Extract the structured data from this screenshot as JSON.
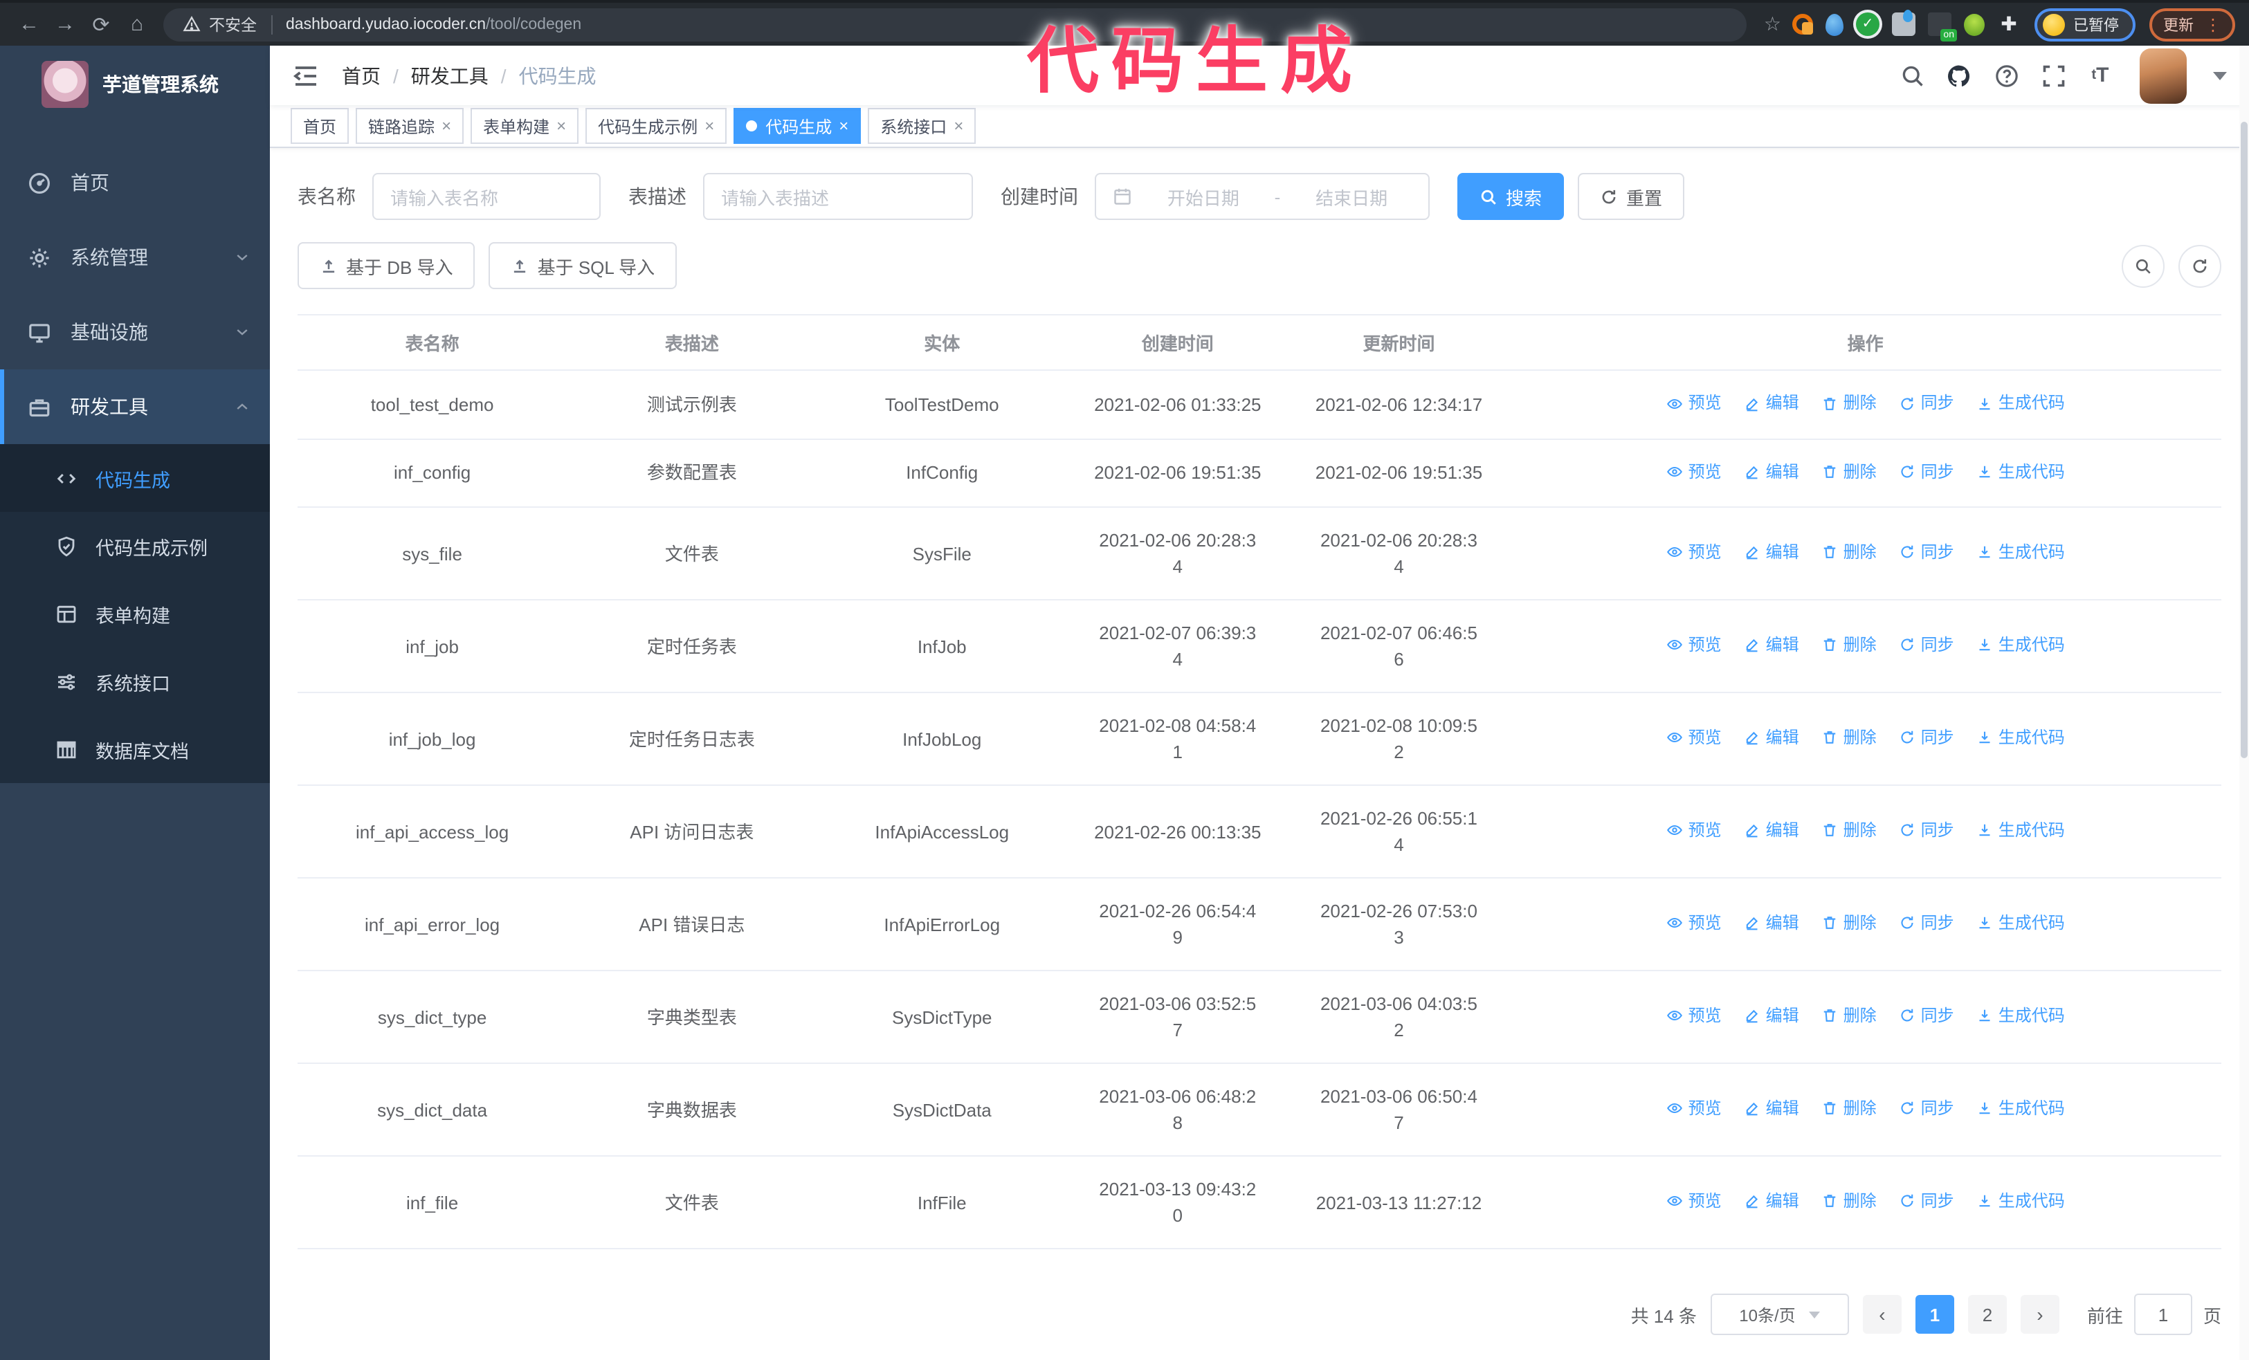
{
  "browser": {
    "security_label": "不安全",
    "url_host": "dashboard.yudao.iocoder.cn",
    "url_path": "/tool/codegen",
    "profile_chip_label": "已暂停",
    "update_button_label": "更新"
  },
  "annotation": {
    "text": "代码生成",
    "color": "#fb3e63"
  },
  "sidebar": {
    "logo_title": "芋道管理系统",
    "menu": [
      {
        "label": "首页"
      },
      {
        "label": "系统管理"
      },
      {
        "label": "基础设施"
      },
      {
        "label": "研发工具"
      }
    ],
    "submenu": [
      {
        "label": "代码生成"
      },
      {
        "label": "代码生成示例"
      },
      {
        "label": "表单构建"
      },
      {
        "label": "系统接口"
      },
      {
        "label": "数据库文档"
      }
    ]
  },
  "navbar": {
    "breadcrumb": [
      "首页",
      "研发工具",
      "代码生成"
    ],
    "breadcrumb_sep": "/"
  },
  "tabs": [
    {
      "label": "首页"
    },
    {
      "label": "链路追踪"
    },
    {
      "label": "表单构建"
    },
    {
      "label": "代码生成示例"
    },
    {
      "label": "代码生成",
      "active": true
    },
    {
      "label": "系统接口"
    }
  ],
  "filters": {
    "table_name_label": "表名称",
    "table_name_placeholder": "请输入表名称",
    "table_desc_label": "表描述",
    "table_desc_placeholder": "请输入表描述",
    "create_time_label": "创建时间",
    "start_date_placeholder": "开始日期",
    "range_separator": "-",
    "end_date_placeholder": "结束日期",
    "search_label": "搜索",
    "reset_label": "重置"
  },
  "toolbar": {
    "db_import_label": "基于 DB 导入",
    "sql_import_label": "基于 SQL 导入"
  },
  "table": {
    "headers": [
      "表名称",
      "表描述",
      "实体",
      "创建时间",
      "更新时间",
      "操作"
    ],
    "row_actions": [
      {
        "key": "preview",
        "icon": "eye",
        "label": "预览"
      },
      {
        "key": "edit",
        "icon": "edit",
        "label": "编辑"
      },
      {
        "key": "delete",
        "icon": "delete",
        "label": "删除"
      },
      {
        "key": "sync",
        "icon": "sync",
        "label": "同步"
      },
      {
        "key": "generate",
        "icon": "download",
        "label": "生成代码"
      }
    ],
    "rows": [
      {
        "name": "tool_test_demo",
        "description": "测试示例表",
        "entity": "ToolTestDemo",
        "created": "2021-02-06 01:33:25",
        "updated": "2021-02-06 12:34:17"
      },
      {
        "name": "inf_config",
        "description": "参数配置表",
        "entity": "InfConfig",
        "created": "2021-02-06 19:51:35",
        "updated": "2021-02-06 19:51:35"
      },
      {
        "name": "sys_file",
        "description": "文件表",
        "entity": "SysFile",
        "created": "2021-02-06 20:28:3\n4",
        "updated": "2021-02-06 20:28:3\n4"
      },
      {
        "name": "inf_job",
        "description": "定时任务表",
        "entity": "InfJob",
        "created": "2021-02-07 06:39:3\n4",
        "updated": "2021-02-07 06:46:5\n6"
      },
      {
        "name": "inf_job_log",
        "description": "定时任务日志表",
        "entity": "InfJobLog",
        "created": "2021-02-08 04:58:4\n1",
        "updated": "2021-02-08 10:09:5\n2"
      },
      {
        "name": "inf_api_access_log",
        "description": "API 访问日志表",
        "entity": "InfApiAccessLog",
        "created": "2021-02-26 00:13:35",
        "updated": "2021-02-26 06:55:1\n4"
      },
      {
        "name": "inf_api_error_log",
        "description": "API 错误日志",
        "entity": "InfApiErrorLog",
        "created": "2021-02-26 06:54:4\n9",
        "updated": "2021-02-26 07:53:0\n3"
      },
      {
        "name": "sys_dict_type",
        "description": "字典类型表",
        "entity": "SysDictType",
        "created": "2021-03-06 03:52:5\n7",
        "updated": "2021-03-06 04:03:5\n2"
      },
      {
        "name": "sys_dict_data",
        "description": "字典数据表",
        "entity": "SysDictData",
        "created": "2021-03-06 06:48:2\n8",
        "updated": "2021-03-06 06:50:4\n7"
      },
      {
        "name": "inf_file",
        "description": "文件表",
        "entity": "InfFile",
        "created": "2021-03-13 09:43:2\n0",
        "updated": "2021-03-13 11:27:12"
      }
    ]
  },
  "pagination": {
    "total_text": "共 14 条",
    "page_size": "10条/页",
    "pages": [
      "1",
      "2"
    ],
    "current_page": "1",
    "goto_label": "前往",
    "goto_value": "1",
    "page_unit": "页"
  },
  "colors": {
    "accent": "#409EFF",
    "sidebar_bg": "#304156",
    "submenu_bg": "#1f2d3d",
    "annotation": "#fb3e63"
  }
}
